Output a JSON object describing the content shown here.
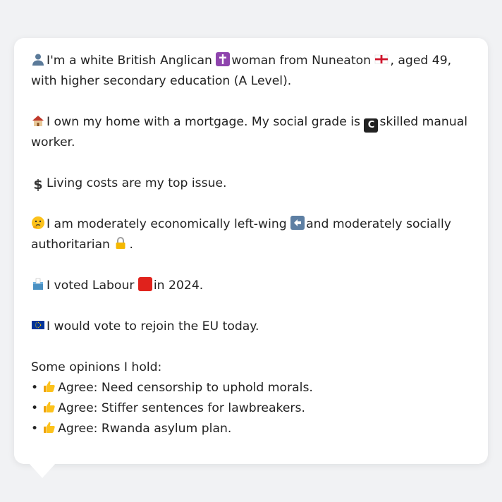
{
  "profile": {
    "identity": {
      "emoji": "person-silhouette-icon",
      "text_a": "I'm a white British Anglican",
      "text_b": "woman from Nuneaton",
      "text_c": ", aged 49, with higher secondary education (A Level)."
    },
    "housing": {
      "emoji": "house-icon",
      "text_a": "I own my home with a mortgage. My social grade is",
      "text_b": "skilled manual worker."
    },
    "issue": {
      "emoji": "dollar-icon",
      "text": "Living costs are my top issue."
    },
    "ideology": {
      "emoji": "thinking-face-icon",
      "text_a": "I am moderately economically left-wing",
      "text_b": "and moderately socially authoritarian",
      "text_c": "."
    },
    "vote": {
      "emoji": "ballot-box-icon",
      "text_a": "I voted Labour",
      "text_b": "in 2024."
    },
    "eu": {
      "emoji": "eu-flag-icon",
      "text": "I would vote to rejoin the EU today."
    },
    "opinions": {
      "heading": "Some opinions I hold:",
      "bullet": "•",
      "items": [
        {
          "label": "Agree: Need censorship to uphold morals."
        },
        {
          "label": "Agree: Stiffer sentences for lawbreakers."
        },
        {
          "label": "Agree: Rwanda asylum plan."
        }
      ]
    }
  },
  "colors": {
    "background": "#f1f2f4",
    "bubble": "#ffffff",
    "text": "#222222",
    "cross_purple": "#8e44ad",
    "labour_red": "#e0221c",
    "eu_blue": "#003399"
  }
}
